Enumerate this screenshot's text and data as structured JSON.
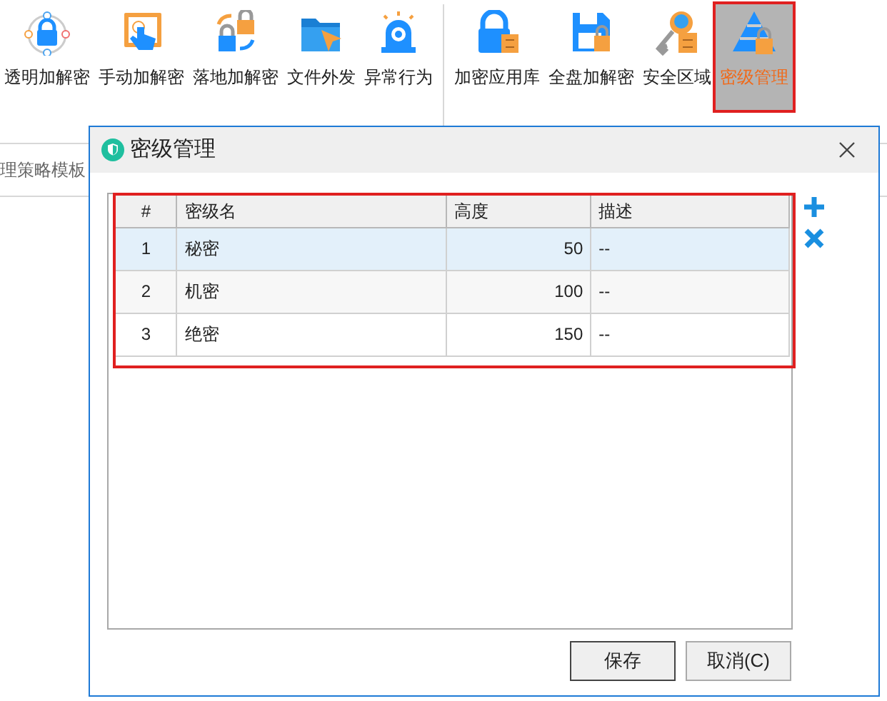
{
  "toolbar": {
    "items": [
      {
        "label": "透明加解密",
        "kind": "lock",
        "selected": false
      },
      {
        "label": "手动加解密",
        "kind": "hand",
        "selected": false
      },
      {
        "label": "落地加解密",
        "kind": "padlocks",
        "selected": false
      },
      {
        "label": "文件外发",
        "kind": "folder",
        "selected": false
      },
      {
        "label": "异常行为",
        "kind": "alarm",
        "selected": false
      },
      {
        "label": "加密应用库",
        "kind": "cabinet",
        "selected": false
      },
      {
        "label": "全盘加解密",
        "kind": "disk",
        "selected": false
      },
      {
        "label": "安全区域",
        "kind": "key",
        "selected": false
      },
      {
        "label": "密级管理",
        "kind": "pyramid",
        "selected": true
      }
    ]
  },
  "sidebar": {
    "text": "理策略模板"
  },
  "dialog": {
    "title": "密级管理",
    "table": {
      "columns": [
        "#",
        "密级名",
        "高度",
        "描述"
      ],
      "rows": [
        {
          "cells": [
            "1",
            "秘密",
            "50",
            "--"
          ],
          "selected": true
        },
        {
          "cells": [
            "2",
            "机密",
            "100",
            "--"
          ],
          "selected": false
        },
        {
          "cells": [
            "3",
            "绝密",
            "150",
            "--"
          ],
          "selected": false
        }
      ]
    },
    "buttons": [
      {
        "label": "保存",
        "kind": "primary"
      },
      {
        "label": "取消(C)",
        "kind": "normal"
      }
    ]
  }
}
